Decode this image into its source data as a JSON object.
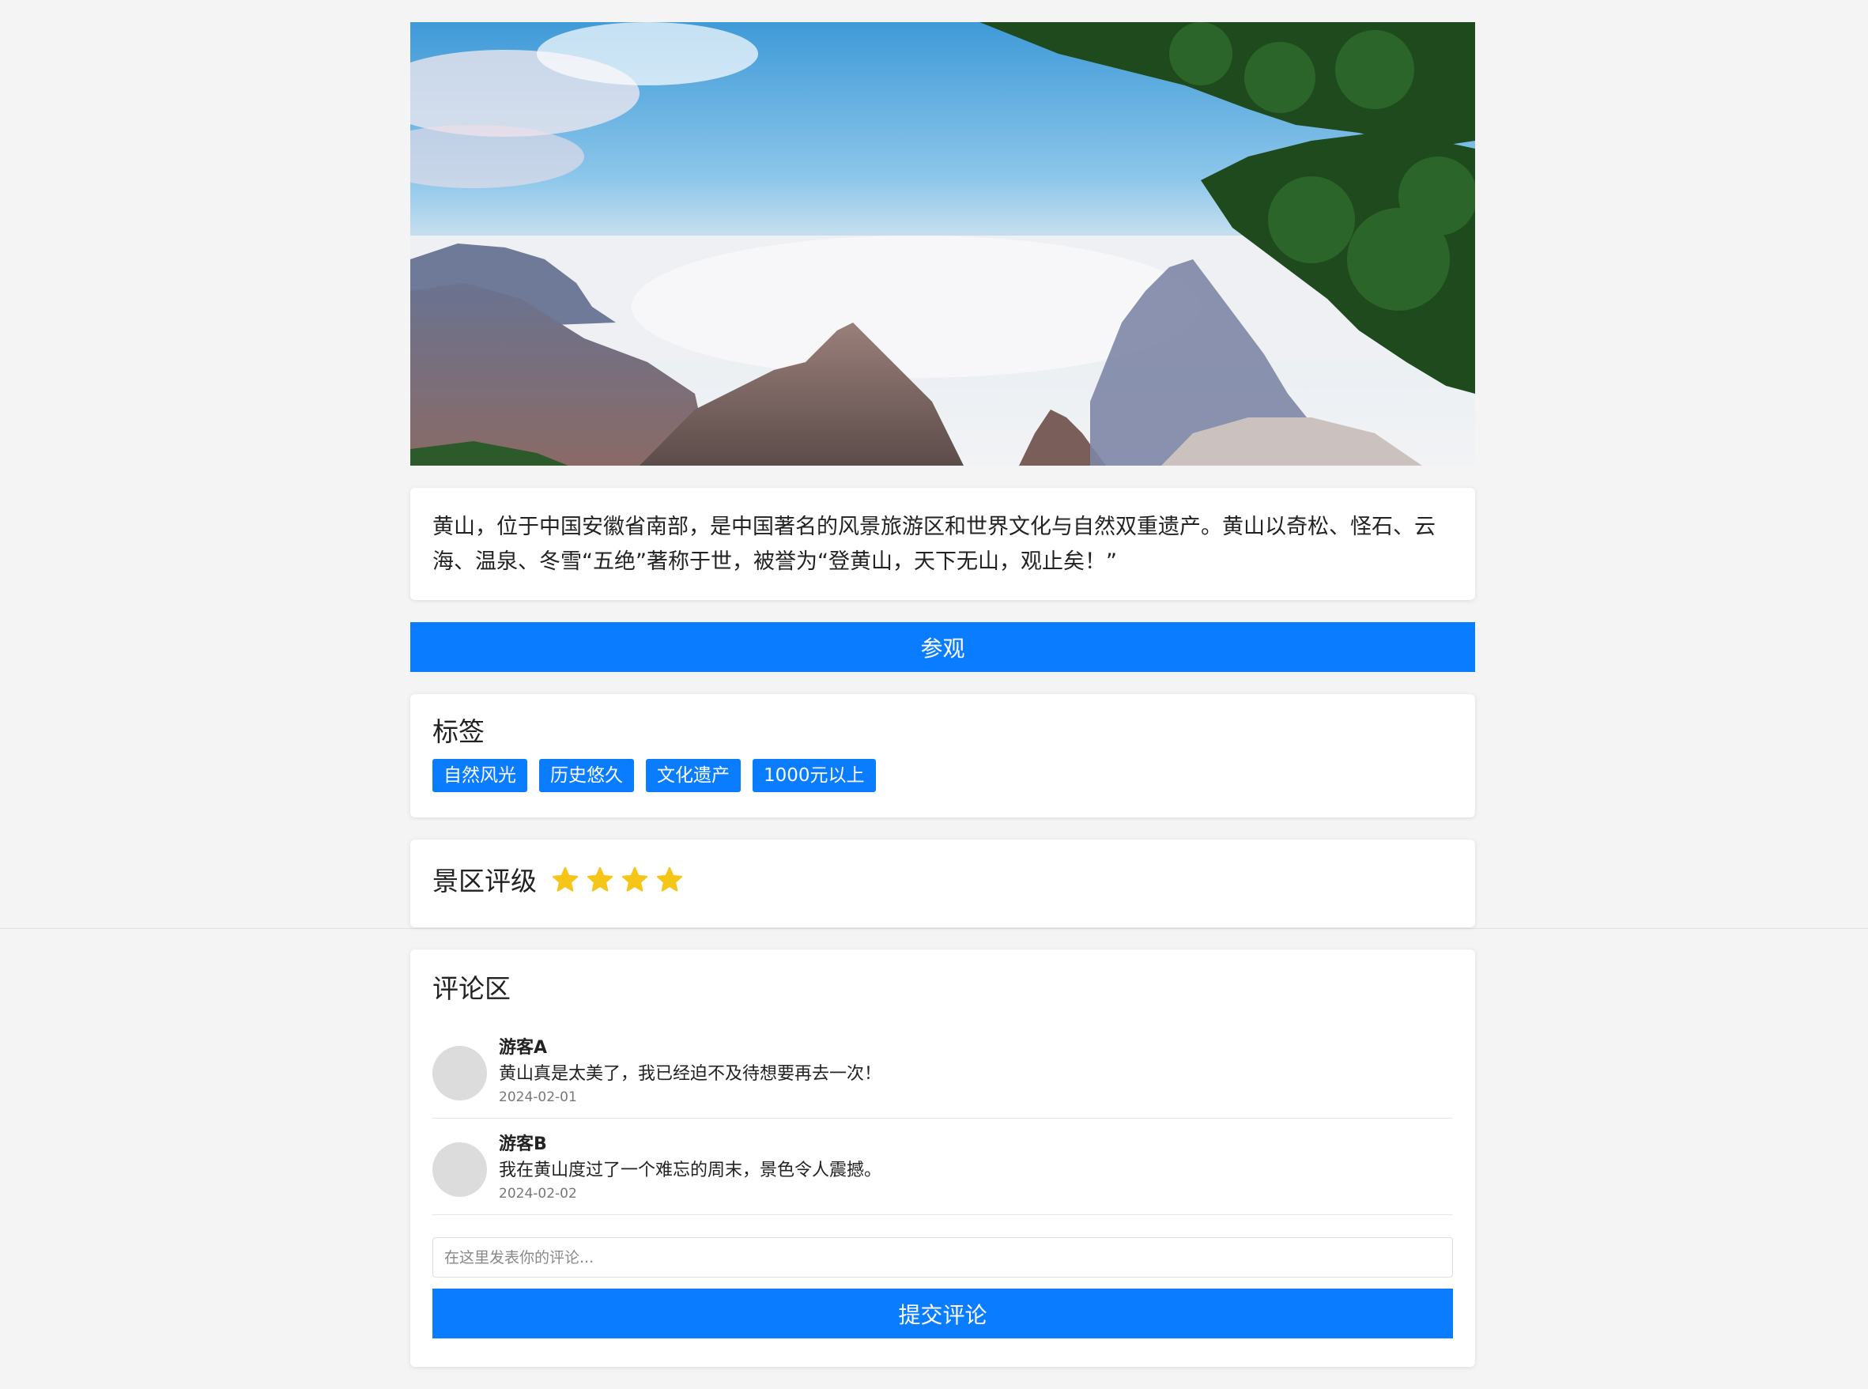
{
  "hero": {
    "image_alt": "黄山云海风景"
  },
  "description": {
    "text": "黄山，位于中国安徽省南部，是中国著名的风景旅游区和世界文化与自然双重遗产。黄山以奇松、怪石、云海、温泉、冬雪“五绝”著称于世，被誉为“登黄山，天下无山，观止矣！”"
  },
  "visit_button": {
    "label": "参观"
  },
  "tags": {
    "title": "标签",
    "items": [
      "自然风光",
      "历史悠久",
      "文化遗产",
      "1000元以上"
    ]
  },
  "rating": {
    "title": "景区评级",
    "stars": 4,
    "star_color": "#f5c518"
  },
  "comments": {
    "title": "评论区",
    "items": [
      {
        "author": "游客A",
        "text": "黄山真是太美了，我已经迫不及待想要再去一次！",
        "date": "2024-02-01"
      },
      {
        "author": "游客B",
        "text": "我在黄山度过了一个难忘的周末，景色令人震撼。",
        "date": "2024-02-02"
      }
    ],
    "input_placeholder": "在这里发表你的评论...",
    "submit_label": "提交评论"
  },
  "colors": {
    "accent": "#0a7cff",
    "background": "#f4f4f4"
  }
}
